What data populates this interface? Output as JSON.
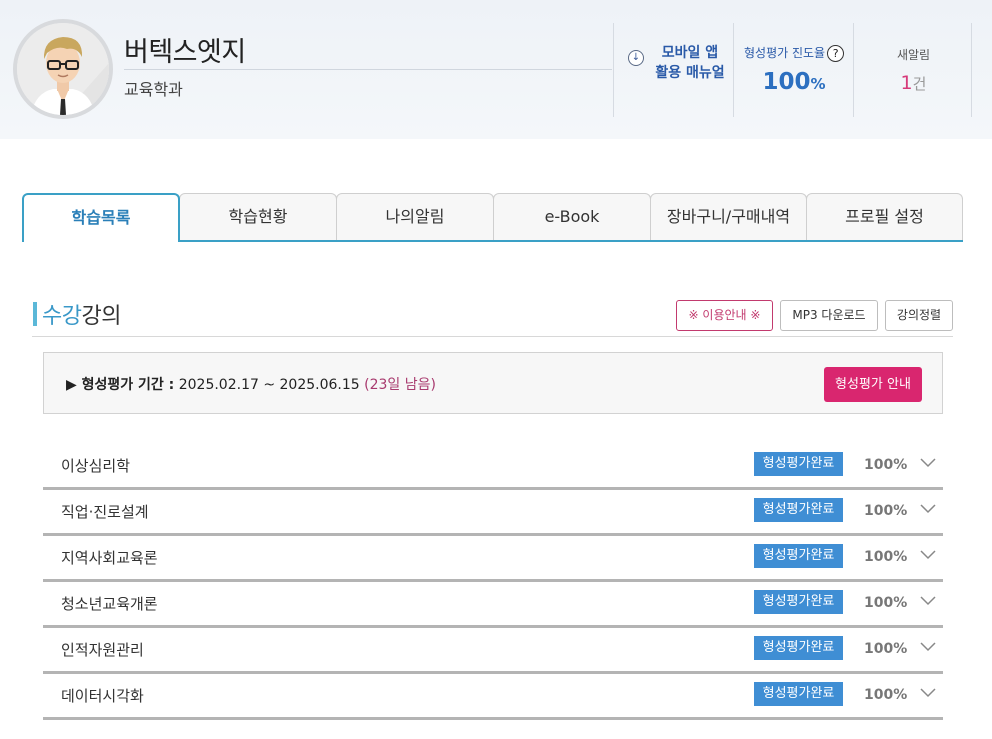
{
  "user": {
    "name": "버텍스엣지",
    "department": "교육학과"
  },
  "manual": {
    "line1": "모바일 앱",
    "line2": "활용 매뉴얼"
  },
  "progress": {
    "label": "형성평가 진도율",
    "help": "?",
    "value": "100",
    "unit": "%"
  },
  "alerts": {
    "label": "새알림",
    "count": "1",
    "unit": "건"
  },
  "tabs": [
    "학습목록",
    "학습현황",
    "나의알림",
    "e-Book",
    "장바구니/구매내역",
    "프로필 설정"
  ],
  "section": {
    "title_highlight": "수강",
    "title_rest": "강의"
  },
  "buttons": {
    "guide": "※ 이용안내 ※",
    "mp3": "MP3 다운로드",
    "sort": "강의정렬"
  },
  "period": {
    "label": "▶ 형성평가 기간 :",
    "range": " 2025.02.17 ~ 2025.06.15 ",
    "remaining": "(23일 남음)",
    "button": "형성평가 안내"
  },
  "courses": [
    {
      "name": "이상심리학",
      "status": "형성평가완료",
      "percent": "100%"
    },
    {
      "name": "직업·진로설계",
      "status": "형성평가완료",
      "percent": "100%"
    },
    {
      "name": "지역사회교육론",
      "status": "형성평가완료",
      "percent": "100%"
    },
    {
      "name": "청소년교육개론",
      "status": "형성평가완료",
      "percent": "100%"
    },
    {
      "name": "인적자원관리",
      "status": "형성평가완료",
      "percent": "100%"
    },
    {
      "name": "데이터시각화",
      "status": "형성평가완료",
      "percent": "100%"
    }
  ],
  "colors": {
    "accent": "#3aa0c6",
    "brand_pink": "#d9266f",
    "badge_blue": "#3f8ed4"
  },
  "icons": [
    "avatar",
    "download-circle-icon",
    "help-circle-icon",
    "chevron-down-icon"
  ]
}
